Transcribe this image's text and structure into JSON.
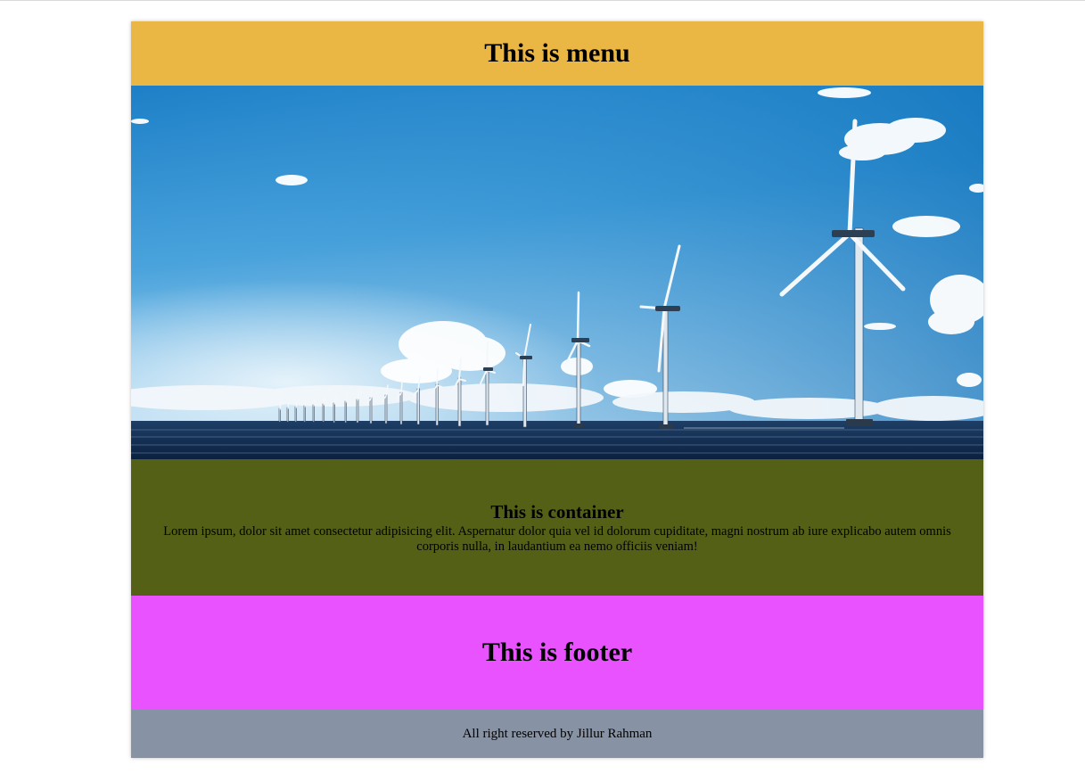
{
  "menu": {
    "title": "This is menu",
    "background": "#EAB644"
  },
  "banner": {
    "image": "wind-turbines-at-sea"
  },
  "container": {
    "heading": "This is container",
    "text": "Lorem ipsum, dolor sit amet consectetur adipisicing elit. Aspernatur dolor quia vel id dolorum cupiditate, magni nostrum ab iure explicabo autem omnis corporis nulla, in laudantium ea nemo officiis veniam!",
    "background": "#556017"
  },
  "footer": {
    "title": "This is footer",
    "background": "#E952FF"
  },
  "copyright": {
    "text": "All right reserved by Jillur Rahman",
    "background": "#8793A5"
  }
}
